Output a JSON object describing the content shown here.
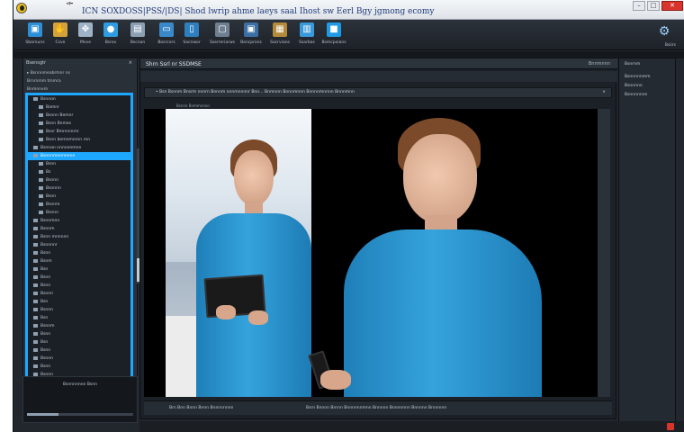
{
  "window": {
    "back_label": "< ̴̴̴̴̴̴̴",
    "title": "ICN SOXDOSS|PSS/|DS|  Shod lwrip ahme laeys saal Ihost sw Eerl Bgy jgmong ecomy",
    "controls": {
      "minimize": "–",
      "maximize": "□",
      "close": "✕"
    }
  },
  "toolbar": {
    "items": [
      {
        "label": "Sbarnuns",
        "icon": "tablet-icon",
        "glyph": "▣",
        "color": "#2d8fd6"
      },
      {
        "label": "Csve",
        "icon": "hand-icon",
        "glyph": "✋",
        "color": "#d4a23a"
      },
      {
        "label": "Mvve",
        "icon": "move-icon",
        "glyph": "✥",
        "color": "#9fb3c6"
      },
      {
        "label": "Bsrov",
        "icon": "globe-icon",
        "glyph": "●",
        "color": "#2f9be0"
      },
      {
        "label": "Bscnan",
        "icon": "camera-icon",
        "glyph": "▤",
        "color": "#8ca0b4"
      },
      {
        "label": "Bosrcors",
        "icon": "monitor-icon",
        "glyph": "▭",
        "color": "#3a88c9"
      },
      {
        "label": "Sacnwor",
        "icon": "phone-icon",
        "glyph": "▯",
        "color": "#2f7fbf"
      },
      {
        "label": "Sasrreriarws",
        "icon": "image-icon",
        "glyph": "▢",
        "color": "#6f7f90"
      },
      {
        "label": "Bencprons",
        "icon": "display-icon",
        "glyph": "▣",
        "color": "#3b6fa3"
      },
      {
        "label": "Sacrvians",
        "icon": "folder-icon",
        "glyph": "▦",
        "color": "#b48a3a"
      },
      {
        "label": "Ssarbas",
        "icon": "device-icon",
        "glyph": "▥",
        "color": "#3a9ad9"
      },
      {
        "label": "Bsmcpoians",
        "icon": "tile-icon",
        "glyph": "■",
        "color": "#1f9ae5"
      }
    ],
    "help_label": "Bsiirs",
    "help_glyph": "⚙"
  },
  "left_panel": {
    "header": "Bsensgtr",
    "close": "×",
    "pre_rows": [
      "▸ Bsnnnmeabrmnr ns",
      "Brnrnmm tmmra",
      "Bnmnnvm"
    ],
    "tree": [
      {
        "label": "Bsnnon",
        "level": 0,
        "selected": false
      },
      {
        "label": "Bamnr",
        "level": 1,
        "selected": false
      },
      {
        "label": "Bsnnn Bemnr",
        "level": 1,
        "selected": false
      },
      {
        "label": "Bsnn Bnmes",
        "level": 1,
        "selected": false
      },
      {
        "label": "Bsnr Bmnnnnrnr",
        "level": 1,
        "selected": false
      },
      {
        "label": "Bsnn bemnmnrnn rnn",
        "level": 1,
        "selected": false
      },
      {
        "label": "Bsnnan nnnnnnmnn",
        "level": 0,
        "selected": false
      },
      {
        "label": "Bsnnnmnnnnnnn",
        "level": 0,
        "selected": true
      },
      {
        "label": "Bsnn",
        "level": 1,
        "selected": false
      },
      {
        "label": "Bs",
        "level": 1,
        "selected": false
      },
      {
        "label": "Bsnnn",
        "level": 1,
        "selected": false
      },
      {
        "label": "Bsnnnn",
        "level": 1,
        "selected": false
      },
      {
        "label": "Bsnn",
        "level": 1,
        "selected": false
      },
      {
        "label": "Bsnnm",
        "level": 1,
        "selected": false
      },
      {
        "label": "Bsnnn",
        "level": 1,
        "selected": false
      },
      {
        "label": "Bsnnmnn",
        "level": 0,
        "selected": false
      },
      {
        "label": "Bsnnm",
        "level": 0,
        "selected": false
      },
      {
        "label": "Bsnn mnnnnn",
        "level": 0,
        "selected": false
      },
      {
        "label": "Bsnnnnr",
        "level": 0,
        "selected": false
      },
      {
        "label": "Bsnn",
        "level": 0,
        "selected": false
      },
      {
        "label": "Bsnm",
        "level": 0,
        "selected": false
      },
      {
        "label": "Bsn",
        "level": 0,
        "selected": false
      },
      {
        "label": "Bsnn",
        "level": 0,
        "selected": false
      },
      {
        "label": "Bsnn",
        "level": 0,
        "selected": false
      },
      {
        "label": "Bsnnn",
        "level": 0,
        "selected": false
      },
      {
        "label": "Bsn",
        "level": 0,
        "selected": false
      },
      {
        "label": "Bsnnn",
        "level": 0,
        "selected": false
      },
      {
        "label": "Bsn",
        "level": 0,
        "selected": false
      },
      {
        "label": "Bsnnm",
        "level": 0,
        "selected": false
      },
      {
        "label": "Bsnn",
        "level": 0,
        "selected": false
      },
      {
        "label": "Bsn",
        "level": 0,
        "selected": false
      },
      {
        "label": "Bsnn",
        "level": 0,
        "selected": false
      },
      {
        "label": "Bsnnn",
        "level": 0,
        "selected": false
      },
      {
        "label": "Bsnn",
        "level": 0,
        "selected": false
      },
      {
        "label": "Bsnnn",
        "level": 0,
        "selected": false
      },
      {
        "label": "Bsnnm",
        "level": 0,
        "selected": false
      }
    ],
    "footer": "Bsnnsnn",
    "footer2": "Bsnnnn Bnnnmnn",
    "bottom_label": "Bsnnnnnnn Bsnn"
  },
  "main": {
    "title": "Shrn Ssrl nr SSDMSE",
    "tool_label": "Bnnmnnn",
    "path": "• Bsn Bsnnm Bnsrm nnnrn  Bnnnm nnnmnnnnr  Bnn… Bnmnnn Bnnnmnnn Bnnnnmnnnn  Bnnnmnn",
    "meta": "Bsnnn Bnmmnnnn",
    "status_left": "Brn Bnn Bnnn Bnnn Bnnnnnnnn",
    "status_right": "Bsrn Bnnnn Bnrnn Bnnnnnnmnn Bnnnnn Bnnnnnnn Bnnnnn Bnnnnnn"
  },
  "right_panel": {
    "header": "Bsnrnm",
    "rows": [
      "Bsnnnnnmm",
      "Bsnnnnn",
      "Bsnnnnnnn"
    ]
  }
}
